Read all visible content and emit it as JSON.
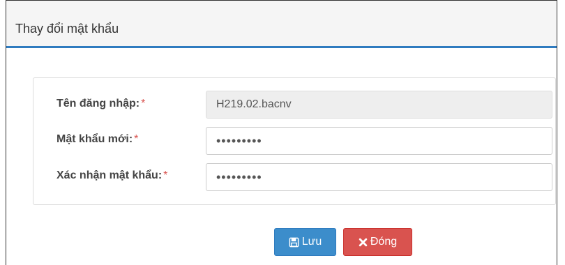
{
  "dialog": {
    "title": "Thay đổi mật khẩu"
  },
  "form": {
    "username": {
      "label": "Tên đăng nhập:",
      "required_mark": "*",
      "value": "H219.02.bacnv"
    },
    "new_password": {
      "label": "Mật khẩu mới:",
      "required_mark": "*",
      "value": "•••••••••"
    },
    "confirm_password": {
      "label": "Xác nhận mật khẩu:",
      "required_mark": "*",
      "value": "•••••••••"
    }
  },
  "buttons": {
    "save": {
      "label": "Lưu",
      "icon": "floppy-disk-icon"
    },
    "close": {
      "label": "Đóng",
      "icon": "x-icon"
    }
  },
  "colors": {
    "accent": "#2f7bbf",
    "save_button": "#3c8dcb",
    "close_button": "#d9534f",
    "required": "#d9534f"
  }
}
